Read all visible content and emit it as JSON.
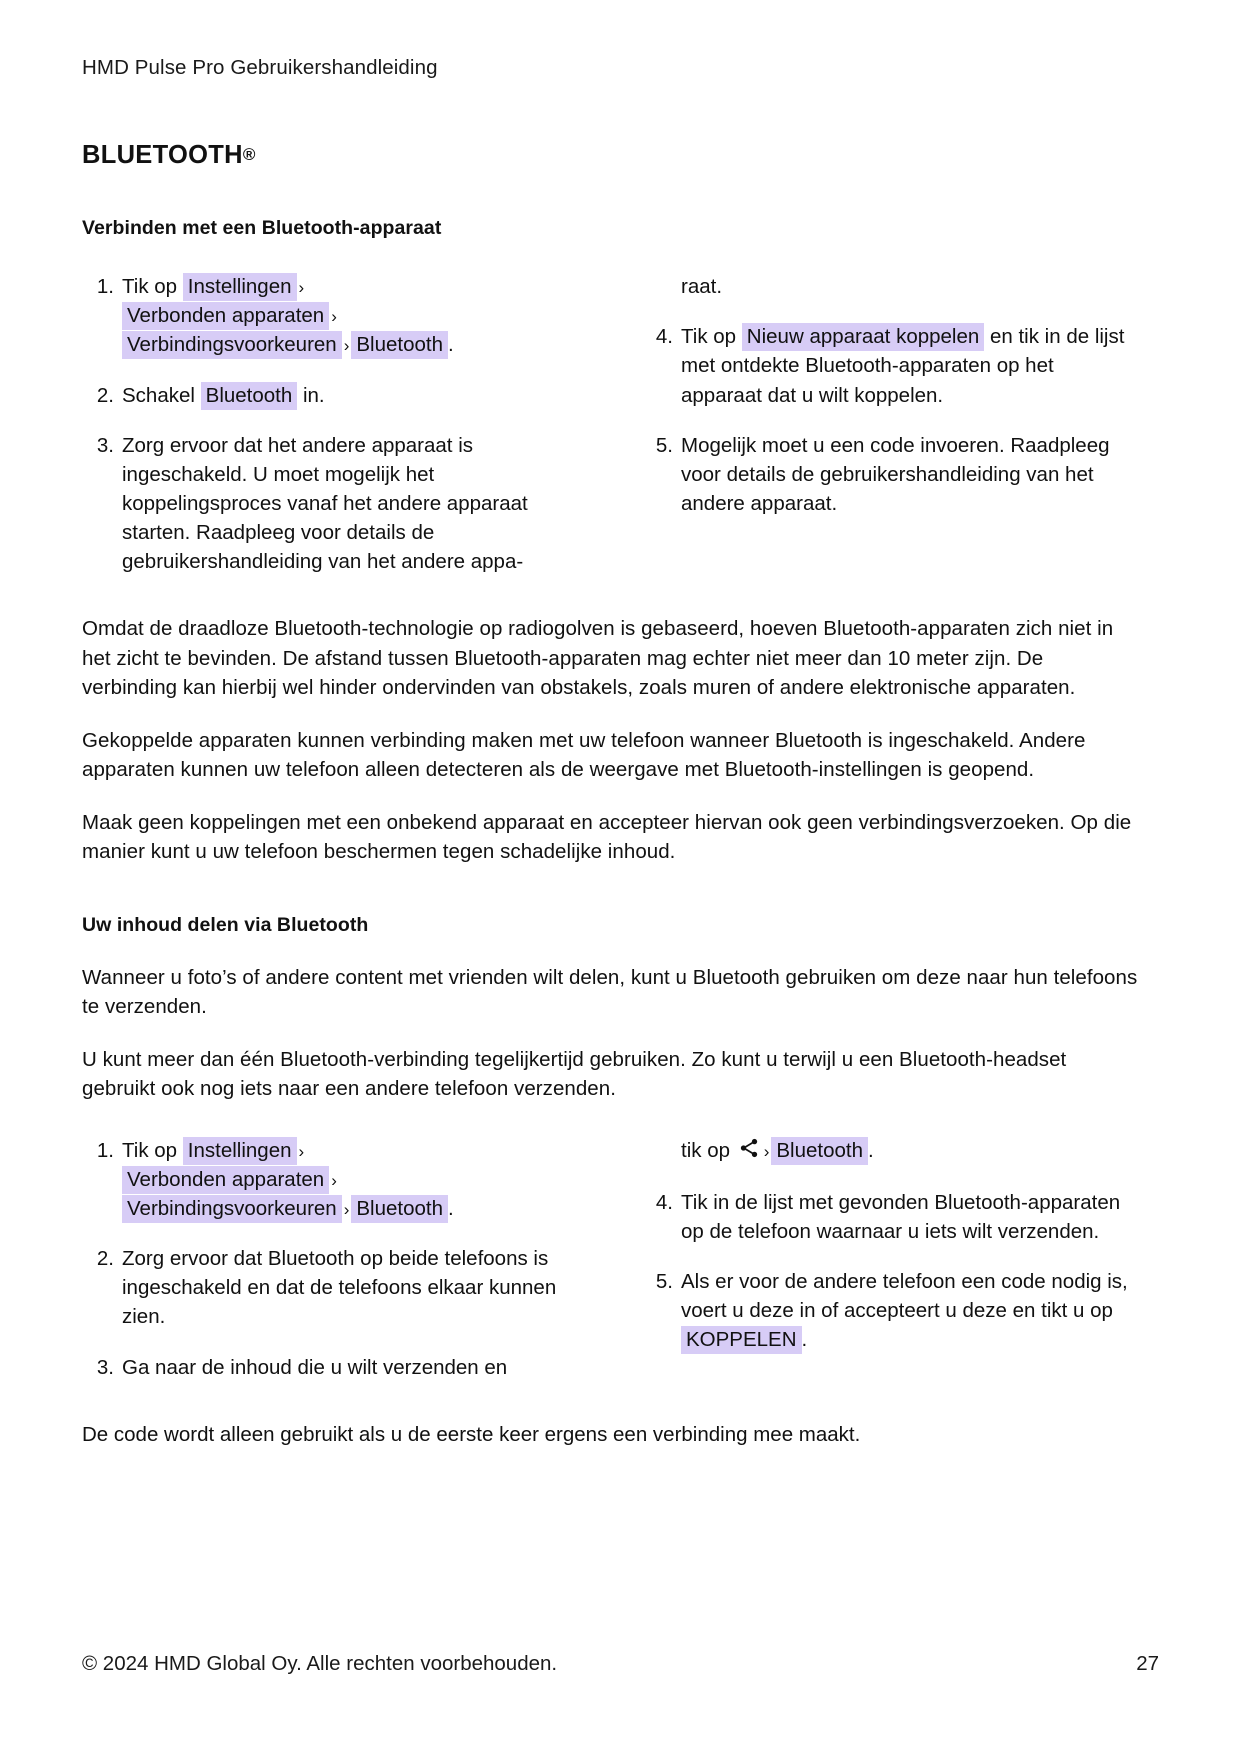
{
  "running_head": "HMD Pulse Pro Gebruikershandleiding",
  "chapter": {
    "title": "BLUETOOTH",
    "trademark": "®"
  },
  "sections": [
    {
      "heading": "Verbinden met een Bluetooth-apparaat",
      "list_left": {
        "items": [
          {
            "number": "1.",
            "lead": "Tik op",
            "chips": [
              "Instellingen",
              "Verbonden apparaten",
              "Verbindingsvoorkeuren",
              "Bluetooth"
            ],
            "separator": "›",
            "trailing": "."
          },
          {
            "number": "2.",
            "lead": "Schakel",
            "chips": [
              "Bluetooth"
            ],
            "trailing": "in."
          },
          {
            "number": "3.",
            "text": "Zorg ervoor dat het andere apparaat is ingeschakeld. U moet mogelijk het koppelingsproces vanaf het andere apparaat starten. Raadpleeg voor details de gebruikershandleiding van het andere appa-"
          }
        ]
      },
      "list_right": {
        "continuation": "raat.",
        "items": [
          {
            "number": "4.",
            "lead": "Tik op",
            "chips": [
              "Nieuw apparaat koppelen"
            ],
            "trailing": "en tik in de lijst met ontdekte Bluetooth-apparaten op het apparaat dat u wilt koppelen."
          },
          {
            "number": "5.",
            "text": "Mogelijk moet u een code invoeren. Raadpleeg voor details de gebruikershandleiding van het andere apparaat."
          }
        ]
      },
      "paragraphs": [
        "Omdat de draadloze Bluetooth-technologie op radiogolven is gebaseerd, hoeven Bluetooth-apparaten zich niet in het zicht te bevinden. De afstand tussen Bluetooth-apparaten mag echter niet meer dan 10 meter zijn. De verbinding kan hierbij wel hinder ondervinden van obstakels, zoals muren of andere elektronische apparaten.",
        "Gekoppelde apparaten kunnen verbinding maken met uw telefoon wanneer Bluetooth is ingeschakeld. Andere apparaten kunnen uw telefoon alleen detecteren als de weergave met Bluetooth-instellingen is geopend.",
        "Maak geen koppelingen met een onbekend apparaat en accepteer hiervan ook geen verbindingsverzoeken. Op die manier kunt u uw telefoon beschermen tegen schadelijke inhoud."
      ]
    },
    {
      "heading": "Uw inhoud delen via Bluetooth",
      "paragraphs": [
        "Wanneer u foto’s of andere content met vrienden wilt delen, kunt u Bluetooth gebruiken om deze naar hun telefoons te verzenden.",
        "U kunt meer dan één Bluetooth-verbinding tegelijkertijd gebruiken. Zo kunt u terwijl u een Bluetooth-headset gebruikt ook nog iets naar een andere telefoon verzenden."
      ],
      "list_left": {
        "items": [
          {
            "number": "1.",
            "lead": "Tik op",
            "chips": [
              "Instellingen",
              "Verbonden apparaten",
              "Verbindingsvoorkeuren",
              "Bluetooth"
            ],
            "separator": "›",
            "trailing": "."
          },
          {
            "number": "2.",
            "text": "Zorg ervoor dat Bluetooth op beide telefoons is ingeschakeld en dat de telefoons elkaar kunnen zien."
          },
          {
            "number": "3.",
            "text": "Ga naar de inhoud die u wilt verzenden en"
          }
        ]
      },
      "list_right": {
        "continuation_lead": "tik op",
        "continuation_icon": "share-icon",
        "continuation_sep": "›",
        "continuation_chip": "Bluetooth",
        "continuation_tail": ".",
        "items": [
          {
            "number": "4.",
            "text": "Tik in de lijst met gevonden Bluetooth-apparaten op de telefoon waarnaar u iets wilt verzenden."
          },
          {
            "number": "5.",
            "lead": "Als er voor de andere telefoon een code nodig is, voert u deze in of accepteert u deze en tikt u op",
            "chips": [
              "KOPPELEN"
            ],
            "trailing": "."
          }
        ]
      },
      "closing_note": "De code wordt alleen gebruikt als u de eerste keer ergens een verbinding mee maakt."
    }
  ],
  "footer": {
    "copyright": "© 2024 HMD Global Oy. Alle rechten voorbehouden.",
    "page_number": "27"
  },
  "colors": {
    "highlight": "#d7ccf6",
    "text": "#111111",
    "background": "#ffffff"
  }
}
